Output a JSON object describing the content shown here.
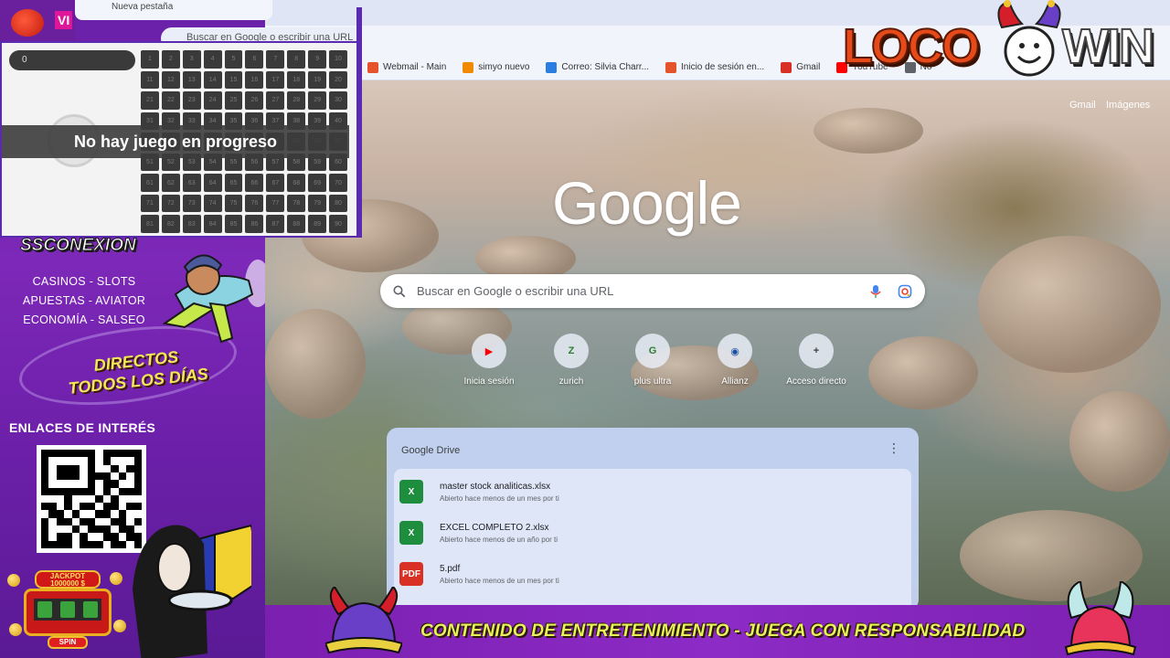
{
  "left_panel": {
    "counter_value": "0",
    "no_game_text": "No hay juego en progreso",
    "brand": "SSCONEXION",
    "lines": [
      "CASINOS - SLOTS",
      "APUESTAS - AVIATOR",
      "ECONOMÍA - SALSEO"
    ],
    "directos_line1": "DIRECTOS",
    "directos_line2": "TODOS LOS DÍAS",
    "enlaces": "ENLACES DE INTERÉS",
    "jackpot_label": "JACKPOT",
    "jackpot_amount": "1000000 $",
    "spin_label": "SPIN",
    "peek_tab": "Nueva pestaña",
    "peek_omnibox": "Buscar en Google o escribir una URL",
    "tomato_text": "VI"
  },
  "bingo_numbers": [
    "1",
    "2",
    "3",
    "4",
    "5",
    "6",
    "7",
    "8",
    "9",
    "10",
    "11",
    "12",
    "13",
    "14",
    "15",
    "16",
    "17",
    "18",
    "19",
    "20",
    "21",
    "22",
    "23",
    "24",
    "25",
    "26",
    "27",
    "28",
    "29",
    "30",
    "31",
    "32",
    "33",
    "34",
    "35",
    "36",
    "37",
    "38",
    "39",
    "40",
    "41",
    "42",
    "43",
    "44",
    "45",
    "46",
    "47",
    "48",
    "49",
    "50",
    "51",
    "52",
    "53",
    "54",
    "55",
    "56",
    "57",
    "58",
    "59",
    "60",
    "61",
    "62",
    "63",
    "64",
    "65",
    "66",
    "67",
    "68",
    "69",
    "70",
    "71",
    "72",
    "73",
    "74",
    "75",
    "76",
    "77",
    "78",
    "79",
    "80",
    "81",
    "82",
    "83",
    "84",
    "85",
    "86",
    "87",
    "88",
    "89",
    "90"
  ],
  "bookmarks": [
    {
      "label": "Webmail - Main",
      "color": "#e5532d"
    },
    {
      "label": "simyo nuevo",
      "color": "#f08a00"
    },
    {
      "label": "Correo: Silvia Charr...",
      "color": "#2a7de1"
    },
    {
      "label": "Inicio de sesión en...",
      "color": "#e5532d"
    },
    {
      "label": "Gmail",
      "color": "#d93025"
    },
    {
      "label": "YouTube",
      "color": "#ff0000"
    },
    {
      "label": "No",
      "color": "#5f6368"
    }
  ],
  "ntp": {
    "gmail_link": "Gmail",
    "images_link": "Imágenes",
    "logo": "Google",
    "search_placeholder": "Buscar en Google o escribir una URL",
    "shortcuts": [
      {
        "label": "Inicia sesión",
        "letter": "▶",
        "color": "#ff0000"
      },
      {
        "label": "zurich",
        "letter": "Z",
        "color": "#2e7d32"
      },
      {
        "label": "plus ultra",
        "letter": "G",
        "color": "#2e7d32"
      },
      {
        "label": "Allianz",
        "letter": "◉",
        "color": "#1a4fa0"
      },
      {
        "label": "Acceso directo",
        "letter": "+",
        "color": "#3c4043"
      }
    ]
  },
  "drive": {
    "title": "Google Drive",
    "menu": "⋮",
    "files": [
      {
        "name": "master stock analiticas.xlsx",
        "sub": "Abierto hace menos de un mes por ti",
        "icon": "X",
        "color": "#1e8e3e"
      },
      {
        "name": "EXCEL COMPLETO 2.xlsx",
        "sub": "Abierto hace menos de un año por ti",
        "icon": "X",
        "color": "#1e8e3e"
      },
      {
        "name": "5.pdf",
        "sub": "Abierto hace menos de un mes por ti",
        "icon": "PDF",
        "color": "#d93025"
      }
    ]
  },
  "bottom_banner": {
    "text": "CONTENIDO DE ENTRETENIMIENTO - JUEGA CON RESPONSABILIDAD"
  },
  "logo": {
    "part1": "LOCO",
    "part2": "WIN"
  }
}
